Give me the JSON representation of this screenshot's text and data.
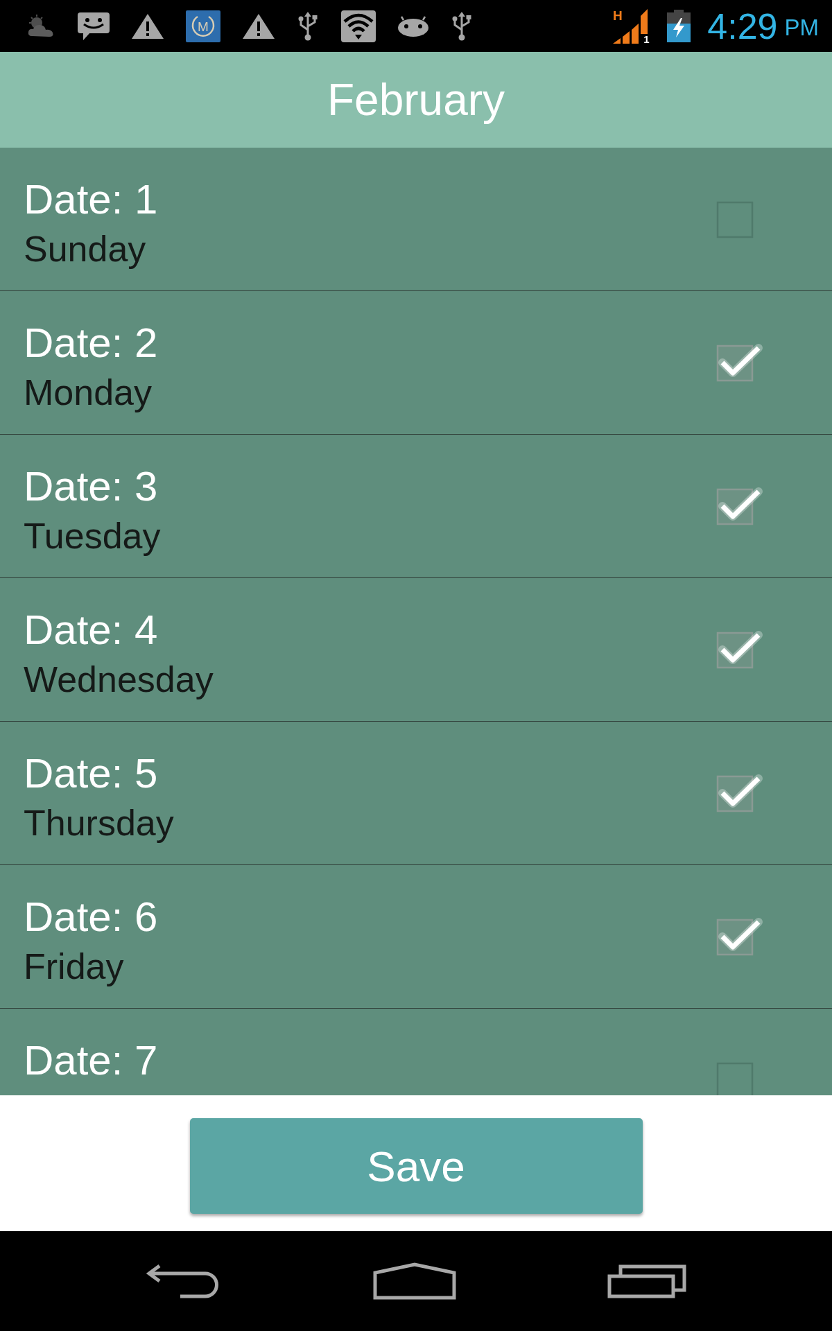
{
  "status_bar": {
    "notifications": [
      {
        "kind": "weather"
      },
      {
        "kind": "message"
      },
      {
        "kind": "warning"
      },
      {
        "kind": "app",
        "label": "M"
      },
      {
        "kind": "warning"
      },
      {
        "kind": "usb"
      },
      {
        "kind": "wifi"
      },
      {
        "kind": "android"
      },
      {
        "kind": "usb"
      }
    ],
    "signal": {
      "network": "H",
      "sim": "1"
    },
    "battery": {
      "charging": true
    },
    "time": "4:29",
    "period": "PM"
  },
  "header": {
    "title": "February"
  },
  "dates": [
    {
      "date": "Date: 1",
      "day": "Sunday",
      "checked": false
    },
    {
      "date": "Date: 2",
      "day": "Monday",
      "checked": true
    },
    {
      "date": "Date: 3",
      "day": "Tuesday",
      "checked": true
    },
    {
      "date": "Date: 4",
      "day": "Wednesday",
      "checked": true
    },
    {
      "date": "Date: 5",
      "day": "Thursday",
      "checked": true
    },
    {
      "date": "Date: 6",
      "day": "Friday",
      "checked": true
    },
    {
      "date": "Date: 7",
      "checked": false
    }
  ],
  "save_button": {
    "label": "Save"
  },
  "nav_bar": {
    "buttons": [
      {
        "kind": "back"
      },
      {
        "kind": "home"
      },
      {
        "kind": "recents"
      }
    ]
  }
}
